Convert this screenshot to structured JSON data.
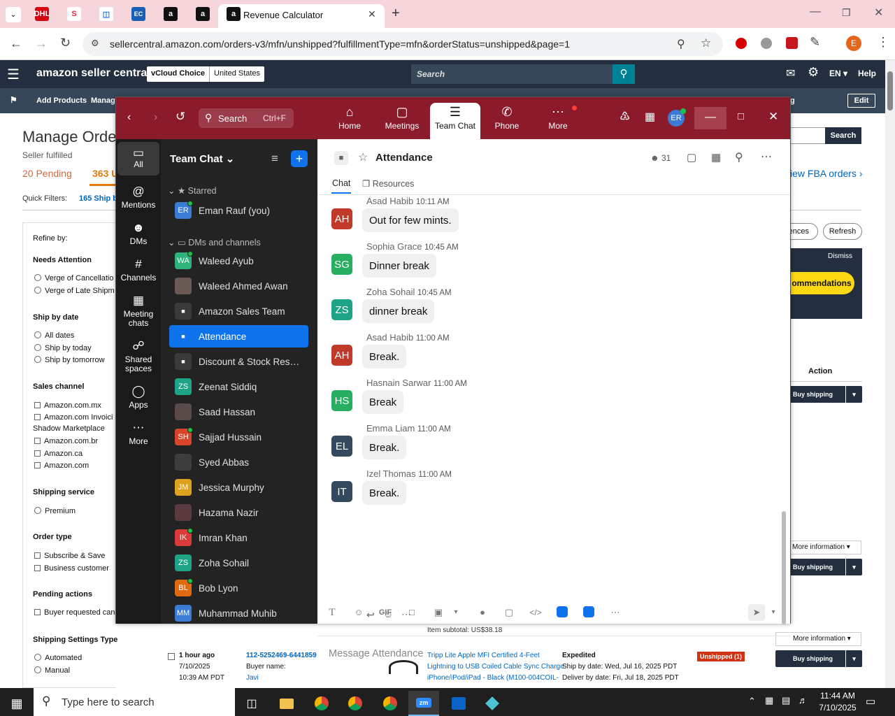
{
  "browser": {
    "tabs": [
      {
        "label": "",
        "icon": "dhl-icon"
      },
      {
        "label": "",
        "icon": "slack-style-icon"
      },
      {
        "label": "",
        "icon": "blue-app-icon"
      },
      {
        "label": "",
        "icon": "ec-icon",
        "text": "EC"
      },
      {
        "label": "",
        "icon": "amazon-icon",
        "text": "a"
      },
      {
        "label": "",
        "icon": "amazon-icon",
        "text": "a"
      },
      {
        "label": "Revenue Calculator",
        "icon": "amazon-icon",
        "text": "a",
        "active": true
      }
    ],
    "url": "sellercentral.amazon.com/orders-v3/mfn/unshipped?fulfillmentType=mfn&orderStatus=unshipped&page=1",
    "profile_initial": "E"
  },
  "seller": {
    "logo": "amazon seller central",
    "store_name": "vCloud Choice",
    "marketplace": "United States",
    "search_placeholder": "Search",
    "lang": "EN",
    "help": "Help",
    "nav": {
      "add_products": "Add Products",
      "manage": "Manage",
      "edit": "Edit",
      "partial_right": "g"
    },
    "page_title": "Manage Orde",
    "subtitle": "Seller fulfilled",
    "pending": "20 Pending",
    "count": "363 U",
    "quick_filters_label": "Quick Filters:",
    "quick_filters_value": "165 Ship b",
    "search_button": "Search",
    "fba_link": "iew FBA orders",
    "preferences_btn": "rences",
    "refresh_btn": "Refresh",
    "dismiss": "Dismiss",
    "recommend_btn": "ommendations",
    "action_header": "Action",
    "buy_shipping": "Buy shipping",
    "more_info": "More information",
    "refine_by": "Refine by:",
    "needs_attention": "Needs Attention",
    "needs_attention_items": [
      "Verge of Cancellatio",
      "Verge of Late Shipm"
    ],
    "ship_by_date": "Ship by date",
    "ship_by_items": [
      "All dates",
      "Ship by today",
      "Ship by tomorrow"
    ],
    "sales_channel": "Sales channel",
    "sales_channel_items": [
      "Amazon.com.mx",
      "Amazon.com Invoici",
      "Shadow Marketplace",
      "Amazon.com.br",
      "Amazon.ca",
      "Amazon.com"
    ],
    "shipping_service": "Shipping service",
    "shipping_service_items": [
      "Premium"
    ],
    "order_type": "Order type",
    "order_type_items": [
      "Subscribe & Save",
      "Business customer"
    ],
    "pending_actions": "Pending actions",
    "pending_actions_items": [
      "Buyer requested can"
    ],
    "shipping_settings": "Shipping Settings Type",
    "shipping_settings_items": [
      "Automated",
      "Manual"
    ],
    "item_subtotal": "Item subtotal: US$38.18",
    "order": {
      "age": "1 hour ago",
      "date": "7/10/2025",
      "time": "10:39 AM PDT",
      "order_id": "112-5252469-6441859",
      "buyer_label": "Buyer name:",
      "buyer": "Javi",
      "product_line1": "Tripp Lite Apple MFI Certified 4-Feet",
      "product_line2": "Lightning to USB Coiled Cable Sync Charge",
      "product_line3": "iPhone/iPod/iPad - Black (M100-004COIL-",
      "service": "Expedited",
      "ship_by": "Ship by date: Wed, Jul 16, 2025 PDT",
      "deliver_by": "Deliver by date: Fri, Jul 18, 2025 PDT",
      "status": "Unshipped (1)"
    }
  },
  "zoom": {
    "search_label": "Search",
    "search_shortcut": "Ctrl+F",
    "tabs": [
      {
        "label": "Home",
        "icon": "home-icon"
      },
      {
        "label": "Meetings",
        "icon": "video-icon"
      },
      {
        "label": "Team Chat",
        "icon": "chat-icon",
        "active": true
      },
      {
        "label": "Phone",
        "icon": "phone-icon"
      },
      {
        "label": "More",
        "icon": "more-icon"
      }
    ],
    "user_initials": "ER",
    "rail": [
      {
        "label": "All",
        "icon": "chat-bubble-icon",
        "active": true
      },
      {
        "label": "Mentions",
        "icon": "at-icon"
      },
      {
        "label": "DMs",
        "icon": "people-icon"
      },
      {
        "label": "Channels",
        "icon": "hash-icon"
      },
      {
        "label": "Meeting chats",
        "icon": "calendar-icon"
      },
      {
        "label": "Shared spaces",
        "icon": "shared-icon"
      },
      {
        "label": "Apps",
        "icon": "apps-icon"
      },
      {
        "label": "More",
        "icon": "more-icon"
      }
    ],
    "sidebar": {
      "title": "Team Chat",
      "starred_label": "Starred",
      "dms_label": "DMs and channels",
      "items": [
        {
          "label": "Eman Rauf (you)",
          "initials": "ER",
          "color": "#3a7bd5",
          "online": true
        },
        {
          "label": "Waleed Ayub",
          "initials": "WA",
          "color": "#2eb37a",
          "online": true
        },
        {
          "label": "Waleed Ahmed Awan",
          "initials": "",
          "color": "#6a5a55",
          "online": false
        },
        {
          "label": "Amazon Sales Team",
          "initials": "",
          "color": "#3a3a3a",
          "locked": true
        },
        {
          "label": "Attendance",
          "initials": "",
          "color": "#0e72ed",
          "locked": true,
          "active": true
        },
        {
          "label": "Discount & Stock Reser...",
          "initials": "",
          "color": "#3a3a3a",
          "locked": true
        },
        {
          "label": "Zeenat Siddiq",
          "initials": "ZS",
          "color": "#1fa387",
          "online": false
        },
        {
          "label": "Saad Hassan",
          "initials": "",
          "color": "#5a4a4a",
          "online": false
        },
        {
          "label": "Sajjad Hussain",
          "initials": "SH",
          "color": "#d9452b",
          "online": true
        },
        {
          "label": "Syed Abbas",
          "initials": "",
          "color": "#3d3d3d",
          "online": false
        },
        {
          "label": "Jessica Murphy",
          "initials": "JM",
          "color": "#e0a020",
          "online": false
        },
        {
          "label": "Hazama Nazir",
          "initials": "",
          "color": "#5a3a3e",
          "online": false
        },
        {
          "label": "Imran Khan",
          "initials": "IK",
          "color": "#d93a3a",
          "online": true
        },
        {
          "label": "Zoha Sohail",
          "initials": "ZS",
          "color": "#1fa387",
          "online": false
        },
        {
          "label": "Bob Lyon",
          "initials": "BL",
          "color": "#e06a10",
          "online": true
        },
        {
          "label": "Muhammad Muhib",
          "initials": "MM",
          "color": "#3a7bd5",
          "online": false
        }
      ]
    },
    "channel": {
      "name": "Attendance",
      "members": "31",
      "tab_chat": "Chat",
      "tab_resources": "Resources",
      "compose_placeholder": "Message Attendance"
    },
    "messages": [
      {
        "sender": "Asad Habib",
        "time": "10:11 AM",
        "text": "Out for few mints.",
        "initials": "AH",
        "color": "#c0392b"
      },
      {
        "sender": "Sophia Grace",
        "time": "10:45 AM",
        "text": "Dinner break",
        "initials": "SG",
        "color": "#27ae60"
      },
      {
        "sender": "Zoha Sohail",
        "time": "10:45 AM",
        "text": "dinner break",
        "initials": "ZS",
        "color": "#1fa387"
      },
      {
        "sender": "Asad Habib",
        "time": "11:00 AM",
        "text": "Break.",
        "initials": "AH",
        "color": "#c0392b"
      },
      {
        "sender": "Hasnain Sarwar",
        "time": "11:00 AM",
        "text": "Break",
        "initials": "HS",
        "color": "#27ae60"
      },
      {
        "sender": "Emma Liam",
        "time": "11:00 AM",
        "text": "Break.",
        "initials": "EL",
        "color": "#34495e"
      },
      {
        "sender": "Izel Thomas",
        "time": "11:00 AM",
        "text": "Break.",
        "initials": "IT",
        "color": "#34495e"
      }
    ],
    "toolbar_gif": "GIF"
  },
  "taskbar": {
    "search_placeholder": "Type here to search",
    "time": "11:44 AM",
    "date": "7/10/2025"
  }
}
